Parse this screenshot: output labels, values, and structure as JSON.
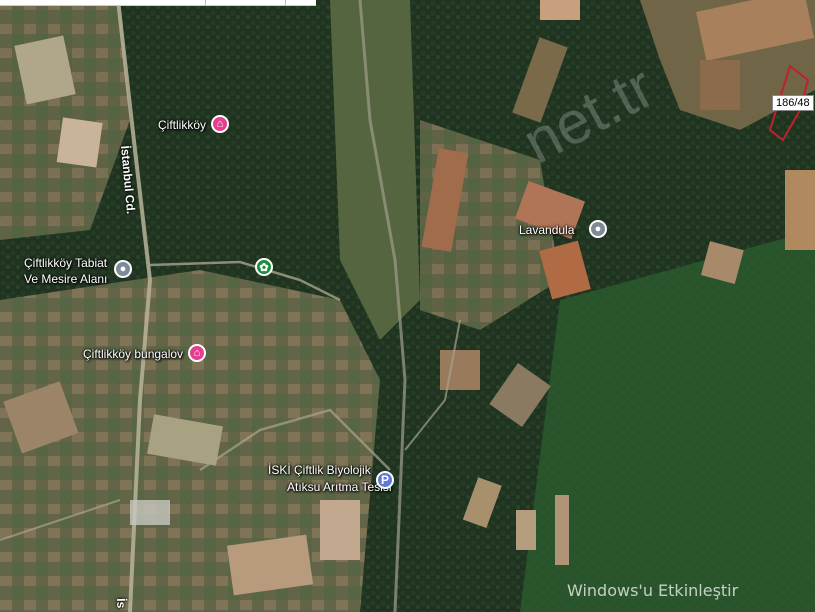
{
  "map": {
    "places": {
      "ciftlikkoy": "Çiftlikköy",
      "tabiat_line1": "Çiftlikköy Tabiat",
      "tabiat_line2": "Ve Mesire Alanı",
      "bungalov": "Çiftlikköy bungalov",
      "lavandula": "Lavandula",
      "iski_line1": "İSKİ Çiftlik Biyolojik",
      "iski_line2": "Atıksu Arıtma Tesisi"
    },
    "roads": {
      "istanbul_cd": "İstanbul Cd.",
      "bottom_fragment": "İs"
    },
    "parcel_label": "186/48",
    "watermark": "net.tr",
    "windows_notice": "Windows'u Etkinleştir",
    "icons": {
      "hotel": "hotel-bed-icon",
      "poi": "place-pin-icon",
      "park": "park-flower-icon",
      "parking": "parking-icon"
    },
    "parking_glyph": "P"
  }
}
